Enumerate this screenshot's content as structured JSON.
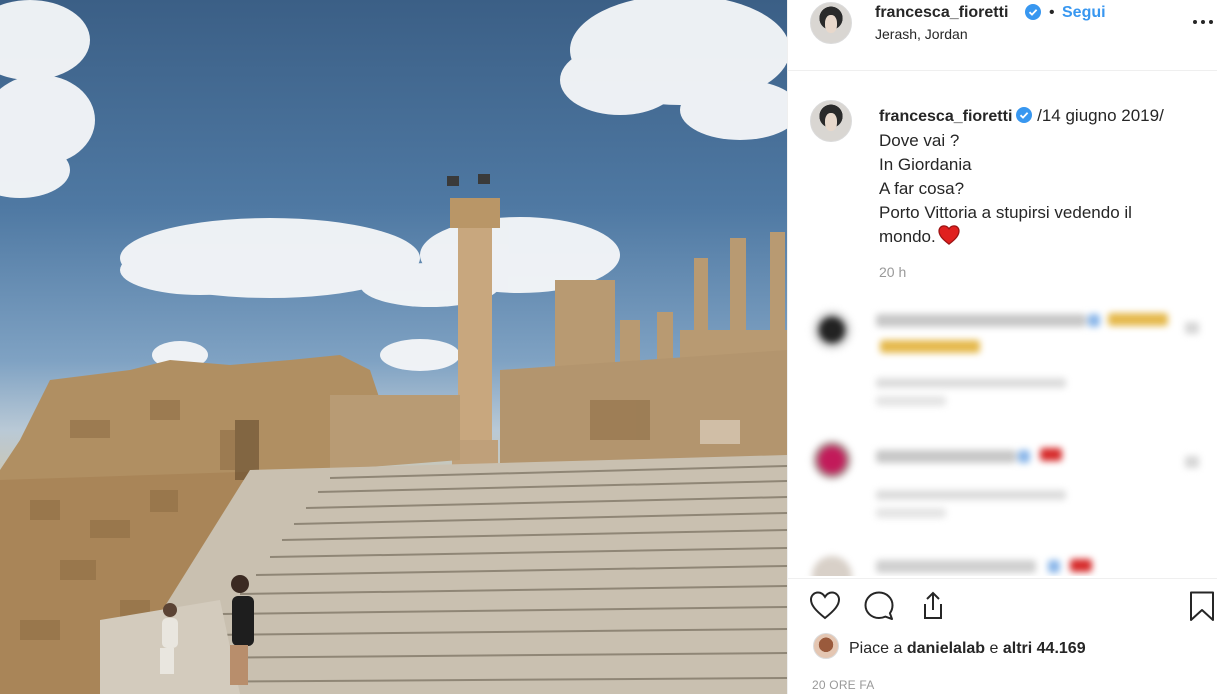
{
  "post": {
    "username": "francesca_fioretti",
    "location": "Jerash, Jordan",
    "separator": "•",
    "follow_label": "Segui"
  },
  "caption": {
    "username": "francesca_fioretti",
    "date": "/14 giugno 2019/",
    "lines": [
      "Dove vai ?",
      "In Giordania",
      "A far cosa?",
      "Porto Vittoria a stupirsi vedendo il",
      "mondo."
    ],
    "emoji": "red-heart",
    "time_ago": "20 h"
  },
  "likes": {
    "prefix": "Piace a ",
    "user": "danielalab",
    "middle": " e ",
    "others": "altri 44.169"
  },
  "timestamp": "20 ORE FA",
  "colors": {
    "accent": "#3897f0",
    "text": "#262626",
    "muted": "#999999",
    "border": "#efefef"
  },
  "icons": [
    "verified-badge-icon",
    "more-options-icon",
    "like-heart-icon",
    "comment-icon",
    "share-icon",
    "bookmark-icon"
  ]
}
